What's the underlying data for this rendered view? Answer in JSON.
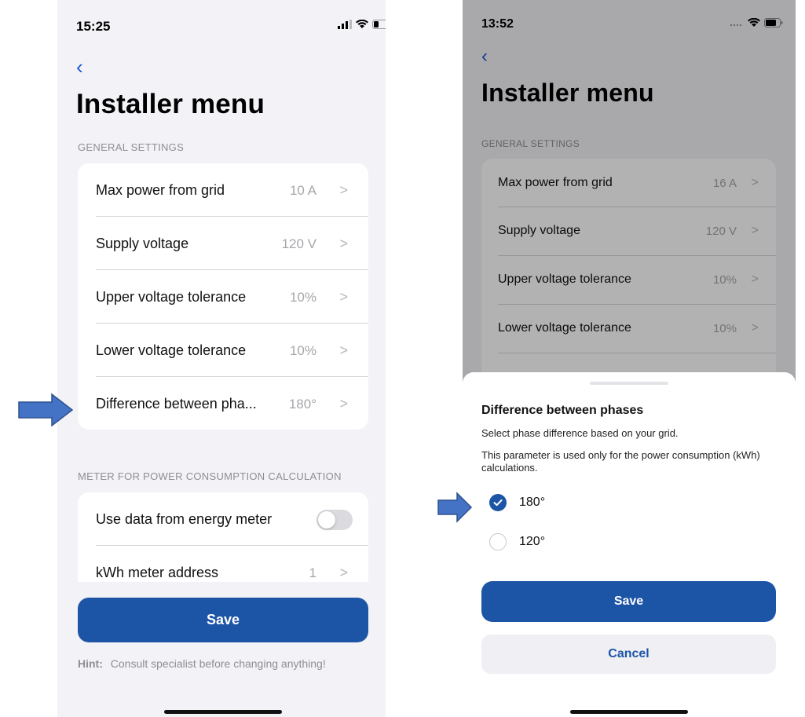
{
  "left": {
    "status": {
      "time": "15:25"
    },
    "title": "Installer menu",
    "general_section": "GENERAL SETTINGS",
    "general_rows": [
      {
        "label": "Max power from grid",
        "value": "10 A"
      },
      {
        "label": "Supply voltage",
        "value": "120 V"
      },
      {
        "label": "Upper voltage tolerance",
        "value": "10%"
      },
      {
        "label": "Lower voltage tolerance",
        "value": "10%"
      },
      {
        "label": "Difference between pha...",
        "value": "180°"
      }
    ],
    "meter_section": "METER FOR POWER CONSUMPTION CALCULATION",
    "meter_rows": {
      "use_meter": {
        "label": "Use data from energy meter",
        "enabled": false
      },
      "address": {
        "label": "kWh meter address",
        "value": "1"
      }
    },
    "save_label": "Save",
    "hint": {
      "prefix": "Hint:",
      "text": "Consult specialist before changing anything!"
    }
  },
  "right": {
    "status": {
      "time": "13:52"
    },
    "title": "Installer menu",
    "general_section": "GENERAL SETTINGS",
    "general_rows": [
      {
        "label": "Max power from grid",
        "value": "16 A"
      },
      {
        "label": "Supply voltage",
        "value": "120 V"
      },
      {
        "label": "Upper voltage tolerance",
        "value": "10%"
      },
      {
        "label": "Lower voltage tolerance",
        "value": "10%"
      }
    ],
    "sheet": {
      "title": "Difference between phases",
      "description": "Select phase difference based on your grid.",
      "note": "This parameter is used only for the power consumption (kWh) calculations.",
      "options": [
        {
          "label": "180°",
          "selected": true
        },
        {
          "label": "120°",
          "selected": false
        }
      ],
      "save_label": "Save",
      "cancel_label": "Cancel"
    }
  },
  "colors": {
    "accent": "#1d55a6",
    "background": "#f2f2f7",
    "arrow": "#4472c4"
  }
}
